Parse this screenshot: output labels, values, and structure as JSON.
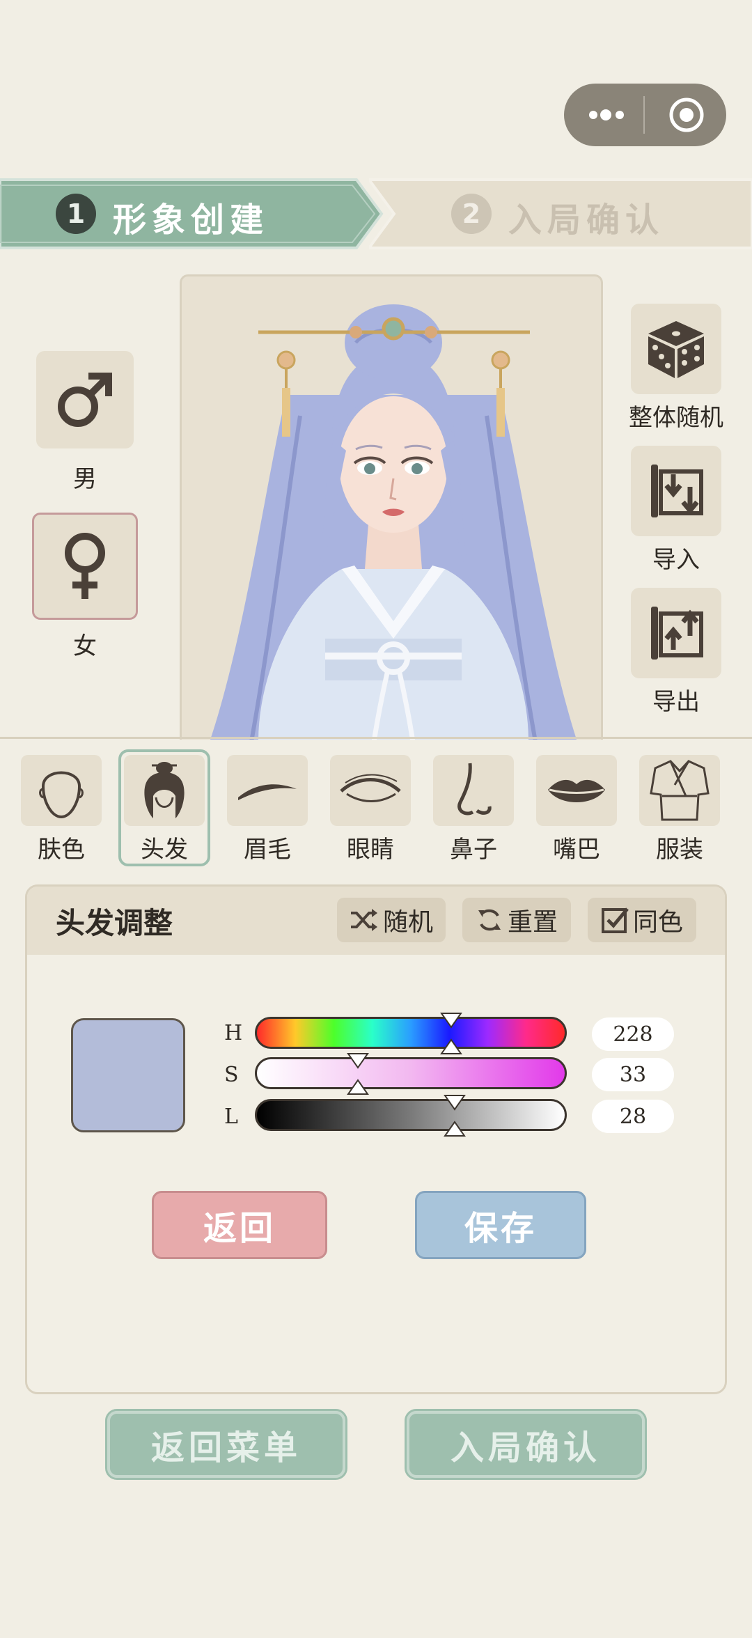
{
  "capsule": {
    "more_icon": "more-dots-icon",
    "close_icon": "target-close-icon"
  },
  "steps": [
    {
      "num": "1",
      "label": "形象创建",
      "active": true
    },
    {
      "num": "2",
      "label": "入局确认",
      "active": false
    }
  ],
  "gender": {
    "male_label": "男",
    "female_label": "女",
    "selected": "female"
  },
  "actions": {
    "random_all": "整体随机",
    "import": "导入",
    "export": "导出"
  },
  "categories": [
    {
      "label": "肤色",
      "icon": "face-outline-icon"
    },
    {
      "label": "头发",
      "icon": "hair-bun-icon",
      "selected": true
    },
    {
      "label": "眉毛",
      "icon": "eyebrow-icon"
    },
    {
      "label": "眼睛",
      "icon": "eye-icon"
    },
    {
      "label": "鼻子",
      "icon": "nose-icon"
    },
    {
      "label": "嘴巴",
      "icon": "lips-icon"
    },
    {
      "label": "服装",
      "icon": "robe-icon"
    }
  ],
  "panel": {
    "title": "头发调整",
    "random_label": "随机",
    "reset_label": "重置",
    "same_color_label": "同色",
    "same_color_checked": true,
    "swatch_color": "#b3bcd9",
    "sliders": [
      {
        "letter": "H",
        "value": "228",
        "fraction": 0.63
      },
      {
        "letter": "S",
        "value": "33",
        "fraction": 0.33
      },
      {
        "letter": "L",
        "value": "28",
        "fraction": 0.64
      }
    ],
    "back_label": "返回",
    "save_label": "保存"
  },
  "footer": {
    "menu_label": "返回菜单",
    "confirm_label": "入局确认"
  },
  "colors": {
    "accent_green": "#8fb5a0",
    "background": "#f1eee4",
    "tile": "#e6dfcf",
    "hair": "#a9b3df"
  }
}
